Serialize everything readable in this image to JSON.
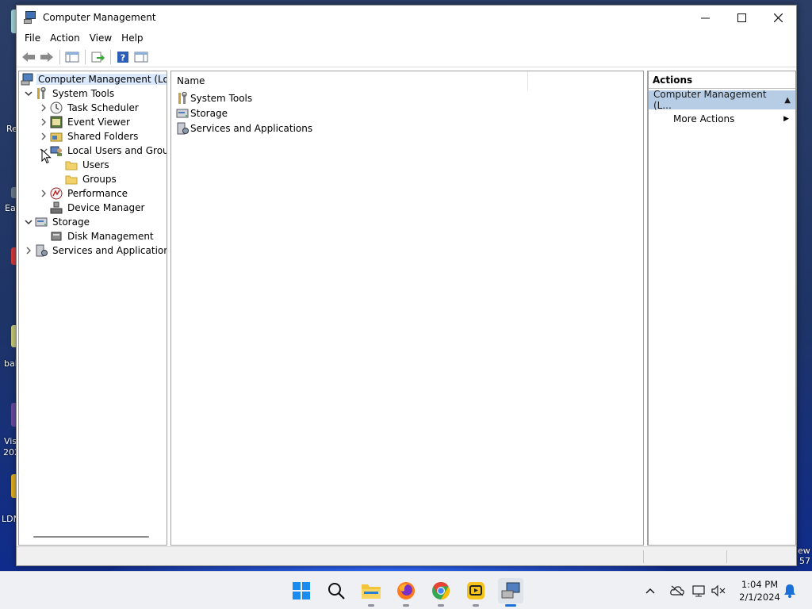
{
  "window": {
    "title": "Computer Management",
    "controls": {
      "minimize": "—",
      "maximize": "☐",
      "close": "✕"
    }
  },
  "menu": [
    "File",
    "Action",
    "View",
    "Help"
  ],
  "tree": {
    "root": "Computer Management (Local",
    "system_tools": "System Tools",
    "task_scheduler": "Task Scheduler",
    "event_viewer": "Event Viewer",
    "shared_folders": "Shared Folders",
    "local_users_groups": "Local Users and Groups",
    "users": "Users",
    "groups": "Groups",
    "performance": "Performance",
    "device_manager": "Device Manager",
    "storage": "Storage",
    "disk_management": "Disk Management",
    "services_apps": "Services and Applications"
  },
  "list": {
    "column_name": "Name",
    "items": [
      "System Tools",
      "Storage",
      "Services and Applications"
    ]
  },
  "actions": {
    "header": "Actions",
    "section": "Computer Management (L...",
    "more_actions": "More Actions"
  },
  "desktop_labels": [
    "Re",
    "Ea",
    "bal",
    "Vis",
    "202",
    "LDN",
    "ew",
    "57"
  ],
  "taskbar": {
    "time": "1:04 PM",
    "date": "2/1/2024"
  },
  "colors": {
    "selection": "#d9e8fb",
    "actions_section": "#b7cde6",
    "accent": "#1b6fd8"
  }
}
